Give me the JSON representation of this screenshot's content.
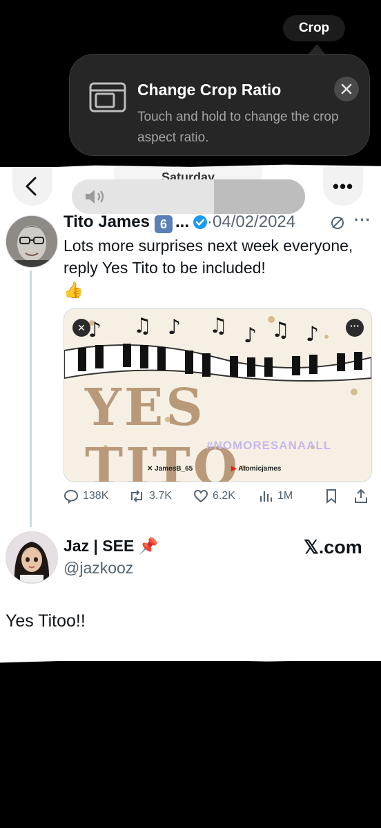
{
  "crop_button": {
    "label": "Crop"
  },
  "tooltip": {
    "title": "Change Crop Ratio",
    "body": "Touch and hold to change the crop aspect ratio.",
    "icon": "crop-ratio-icon",
    "close_icon": "close-icon"
  },
  "header": {
    "ghost_text": "Saturday"
  },
  "tweet": {
    "author": "Tito James",
    "badge": "6",
    "ellipsis": "...",
    "date": "04/02/2024",
    "separator": "·",
    "more": "···",
    "text": "Lots more surprises next week everyone, reply Yes Tito to be included!",
    "emoji": "👍",
    "media": {
      "title": "YES TITO",
      "hashtag": "#NOMORESANAALL",
      "credit_x": "JamesB_65",
      "credit_youtube": "Atomicjames"
    },
    "stats": {
      "replies": "138K",
      "reposts": "3.7K",
      "likes": "6.2K",
      "views": "1M"
    }
  },
  "reply": {
    "author": "Jaz | SEE",
    "pin": "📌",
    "handle": "@jazkooz",
    "site": "𝕏.com",
    "text": "Yes Titoo!!"
  },
  "colors": {
    "verified": "#1d9bf0",
    "background": "#000000",
    "tooltip": "#262626"
  }
}
